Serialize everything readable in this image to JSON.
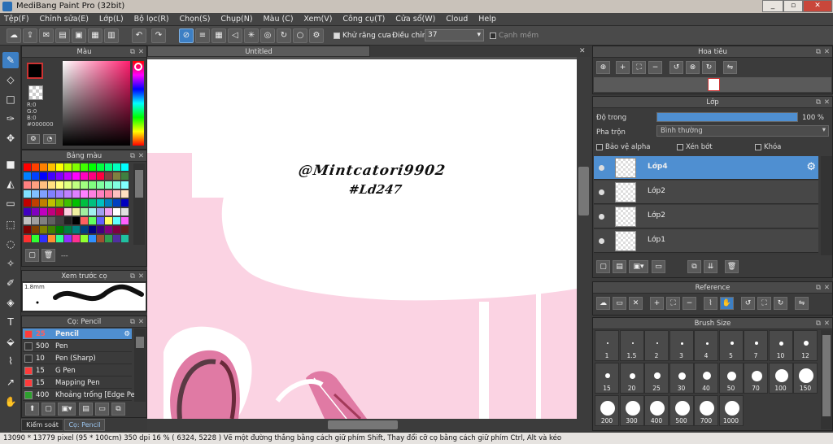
{
  "window": {
    "title": "MediBang Paint Pro (32bit)"
  },
  "menu": [
    "Tệp(F)",
    "Chỉnh sửa(E)",
    "Lớp(L)",
    "Bộ lọc(R)",
    "Chọn(S)",
    "Chụp(N)",
    "Màu (C)",
    "Xem(V)",
    "Công cụ(T)",
    "Cửa sổ(W)",
    "Cloud",
    "Help"
  ],
  "toolbar": {
    "antialias_label": "Khử răng cưa",
    "correction_label": "Điều chỉnh",
    "correction_value": "37",
    "sharp_edge_label": "Cạnh mềm"
  },
  "color_panel": {
    "title": "Màu",
    "r": "R:0",
    "g": "G:0",
    "b": "B:0",
    "hex": "#000000"
  },
  "palette_panel": {
    "title": "Bảng màu",
    "footer": "---"
  },
  "brush_preview": {
    "title": "Xem trước cọ",
    "size": "1.8mm"
  },
  "brush_panel": {
    "title": "Cọ: Pencil",
    "items": [
      {
        "size": "25",
        "name": "Pencil",
        "selected": true
      },
      {
        "size": "500",
        "name": "Pen"
      },
      {
        "size": "10",
        "name": "Pen (Sharp)"
      },
      {
        "size": "15",
        "name": "G Pen"
      },
      {
        "size": "15",
        "name": "Mapping Pen"
      },
      {
        "size": "400",
        "name": "Khoảng trống [Edge Pe"
      }
    ]
  },
  "bottom_tabs": {
    "tab1": "Kiểm soát cọ",
    "tab2": "Cọ: Pencil"
  },
  "document": {
    "tab": "Untitled",
    "watermark_line1": "@Mintcatori9902",
    "watermark_line2": "#Ld247"
  },
  "navigator": {
    "title": "Hoa tiêu"
  },
  "layer_panel": {
    "title": "Lớp",
    "opacity_label": "Độ trong",
    "opacity_value": "100 %",
    "opacity_pct": 100,
    "blend_label": "Pha trộn",
    "blend_value": "Bình thường",
    "protect_alpha": "Bảo vệ alpha",
    "clipping": "Xén bớt",
    "lock": "Khóa",
    "layers": [
      {
        "name": "Lớp4",
        "selected": true
      },
      {
        "name": "Lớp2"
      },
      {
        "name": "Lớp2"
      },
      {
        "name": "Lớp1"
      }
    ]
  },
  "reference_panel": {
    "title": "Reference"
  },
  "brush_size_panel": {
    "title": "Brush Size",
    "sizes": [
      "1",
      "1.5",
      "2",
      "3",
      "4",
      "5",
      "7",
      "10",
      "12",
      "15",
      "20",
      "25",
      "30",
      "40",
      "50",
      "70",
      "100",
      "150",
      "200",
      "300",
      "400",
      "500",
      "700",
      "1000"
    ]
  },
  "status": {
    "text": "13090 * 13779 pixel   (95 * 100cm)   350 dpi   16 %   ( 6324, 5228 )   Vẽ một đường thẳng bằng cách giữ phím Shift, Thay đổi cỡ cọ bằng cách giữ phím Ctrl, Alt và kéo"
  },
  "colors": {
    "accent": "#4f8fd1",
    "canvas_pink": "#fbd3e3",
    "pink_dark": "#e07aa4"
  }
}
